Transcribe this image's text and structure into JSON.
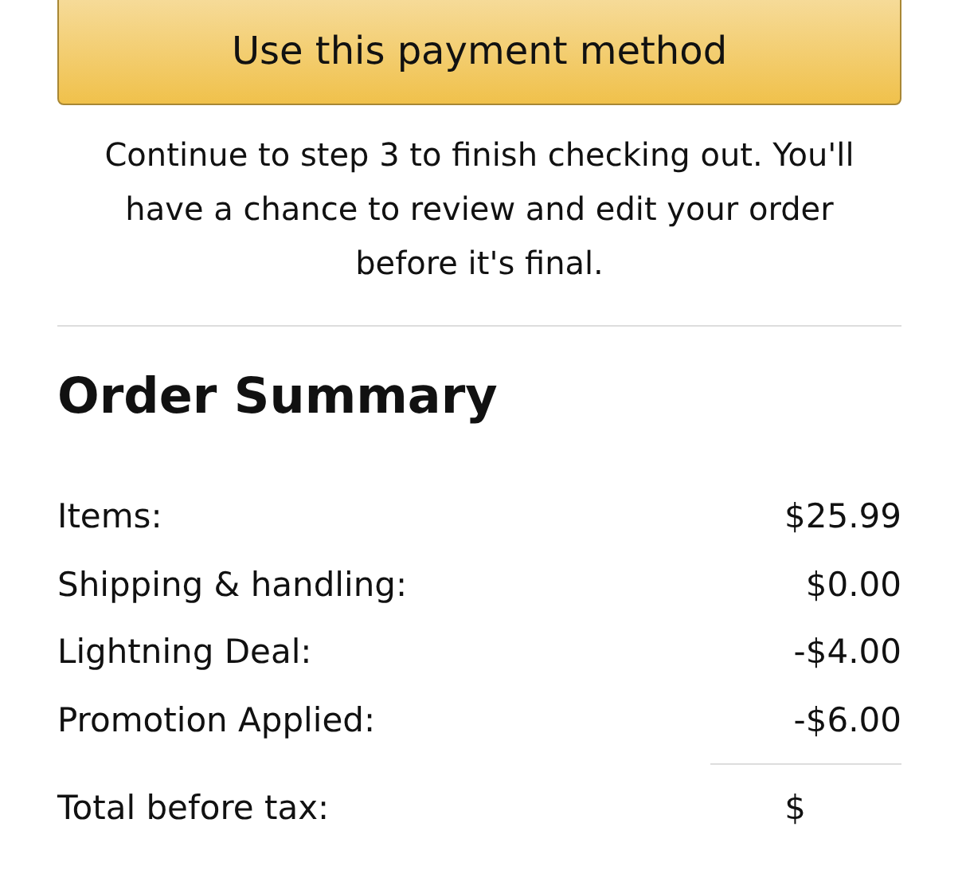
{
  "primary_button": {
    "label": "Use this payment method"
  },
  "note": "Continue to step 3 to finish checking out. You'll have a chance to review and edit your order before it's final.",
  "order_summary": {
    "title": "Order Summary",
    "rows": [
      {
        "label": "Items:",
        "value": "$25.99"
      },
      {
        "label": "Shipping & handling:",
        "value": "$0.00"
      },
      {
        "label": "Lightning Deal:",
        "value": "-$4.00"
      },
      {
        "label": "Promotion Applied:",
        "value": "-$6.00"
      }
    ],
    "total": {
      "label": "Total before tax:",
      "value": "$"
    }
  }
}
